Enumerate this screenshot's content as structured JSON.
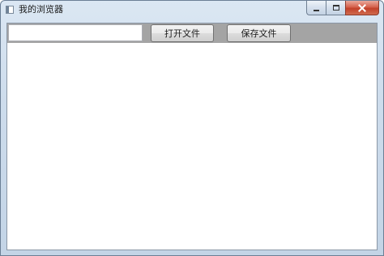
{
  "window": {
    "title": "我的浏览器",
    "buttons": {
      "minimize_icon": "minimize-icon",
      "maximize_icon": "maximize-icon",
      "close_icon": "close-icon"
    }
  },
  "toolbar": {
    "address_value": "",
    "open_file_label": "打开文件",
    "save_file_label": "保存文件"
  },
  "colors": {
    "toolbar_background": "#a4a4a4",
    "close_button": "#c2412a",
    "content_background": "#ffffff"
  }
}
